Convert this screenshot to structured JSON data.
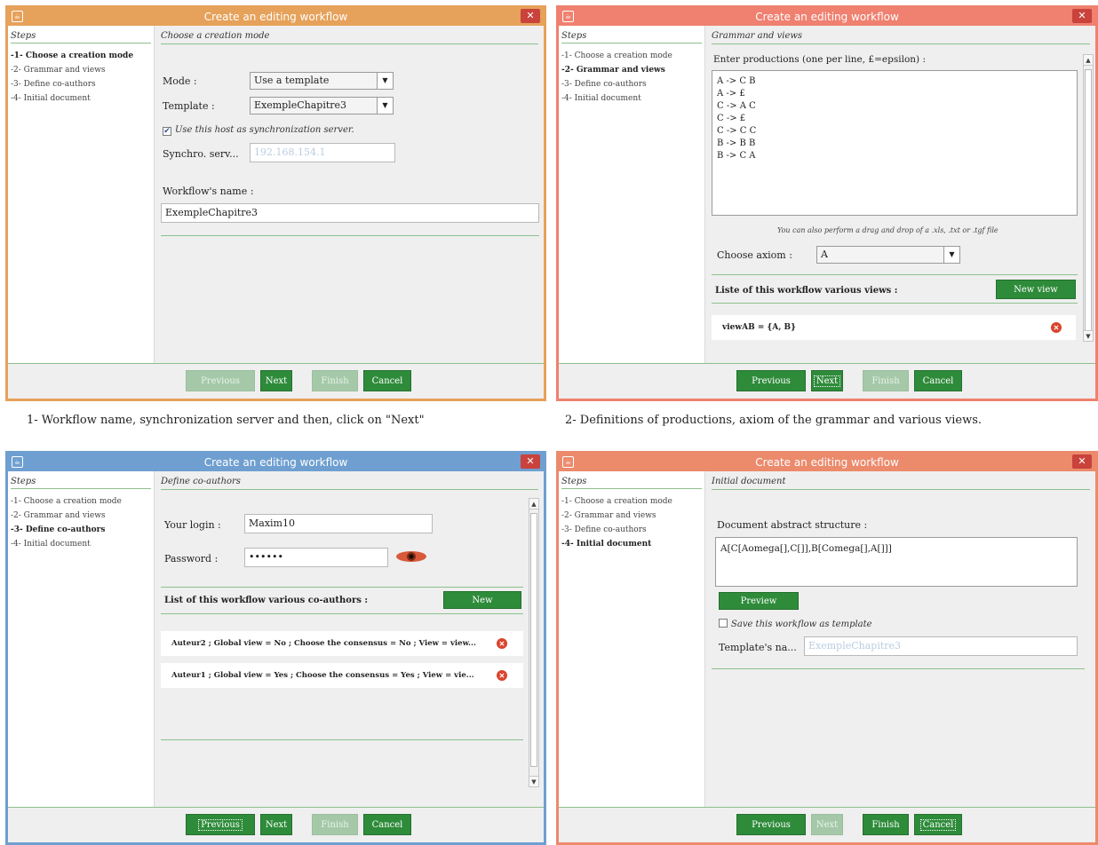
{
  "window_title": "Create an editing workflow",
  "steps_title": "Steps",
  "steps": [
    "-1- Choose a creation mode",
    "-2- Grammar and views",
    "-3- Define co-authors",
    "-4- Initial document"
  ],
  "buttons": {
    "previous": "Previous",
    "next": "Next",
    "finish": "Finish",
    "cancel": "Cancel"
  },
  "panel1": {
    "section_title": "Choose a creation mode",
    "mode_label": "Mode :",
    "mode_value": "Use a template",
    "template_label": "Template :",
    "template_value": "ExempleChapitre3",
    "use_host_label": "Use this host as synchronization server.",
    "synchro_label": "Synchro. serv...",
    "synchro_value": "192.168.154.1",
    "workflow_name_label": "Workflow's name :",
    "workflow_name_value": "ExempleChapitre3"
  },
  "panel2": {
    "section_title": "Grammar and views",
    "productions_label": "Enter productions (one per line, £=epsilon) :",
    "productions": [
      "A -> C B",
      "A -> £",
      "C -> A C",
      "C -> £",
      "C -> C C",
      "B -> B B",
      "B -> C A"
    ],
    "drag_note": "You can also perform a drag and drop of a .xls, .txt or .tgf file",
    "axiom_label": "Choose axiom :",
    "axiom_value": "A",
    "views_label": "Liste of this workflow various views :",
    "new_view_button": "New view",
    "views": [
      "viewAB = {A, B}"
    ]
  },
  "panel3": {
    "section_title": "Define co-authors",
    "login_label": "Your login :",
    "login_value": "Maxim10",
    "password_label": "Password :",
    "password_value": "••••••",
    "coauthors_label": "List of this workflow various co-authors :",
    "new_button": "New",
    "coauthors": [
      "Auteur2 ; Global view = No ; Choose the consensus = No ; View = view...",
      "Auteur1 ; Global view = Yes ; Choose the consensus = Yes ; View = vie..."
    ]
  },
  "panel4": {
    "section_title": "Initial document",
    "structure_label": "Document abstract structure :",
    "structure_value": "A[C[Aomega[],C[]],B[Comega[],A[]]]",
    "preview_button": "Preview",
    "save_template_label": "Save this workflow as template",
    "template_name_label": "Template's na...",
    "template_name_value": "ExempleChapitre3"
  },
  "captions": {
    "c1": "1- Workflow name, synchronization server and then, click on \"Next\"",
    "c2": "2- Definitions of productions, axiom of the grammar and various views."
  },
  "colors": {
    "accent_green": "#2e8b3a",
    "win1": "#e6a15a",
    "win2": "#f08070",
    "win3": "#6f9fd0",
    "win4": "#ec8a6c"
  }
}
